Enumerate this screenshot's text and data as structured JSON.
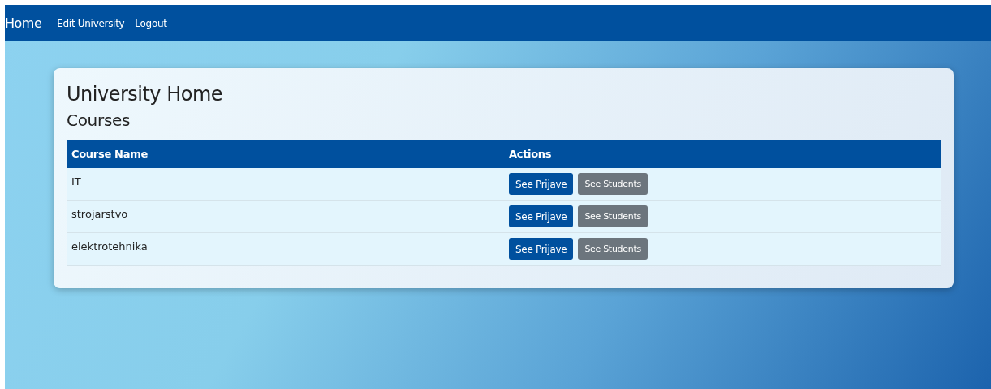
{
  "nav": {
    "brand": "Home",
    "links": [
      "Edit University",
      "Logout"
    ]
  },
  "title": "University Home",
  "subtitle": "Courses",
  "table": {
    "columns": [
      "Course Name",
      "Actions"
    ],
    "rows": [
      {
        "name": "IT",
        "actions": [
          "See Prijave",
          "See Students"
        ]
      },
      {
        "name": "strojarstvo",
        "actions": [
          "See Prijave",
          "See Students"
        ]
      },
      {
        "name": "elektrotehnika",
        "actions": [
          "See Prijave",
          "See Students"
        ]
      }
    ]
  }
}
